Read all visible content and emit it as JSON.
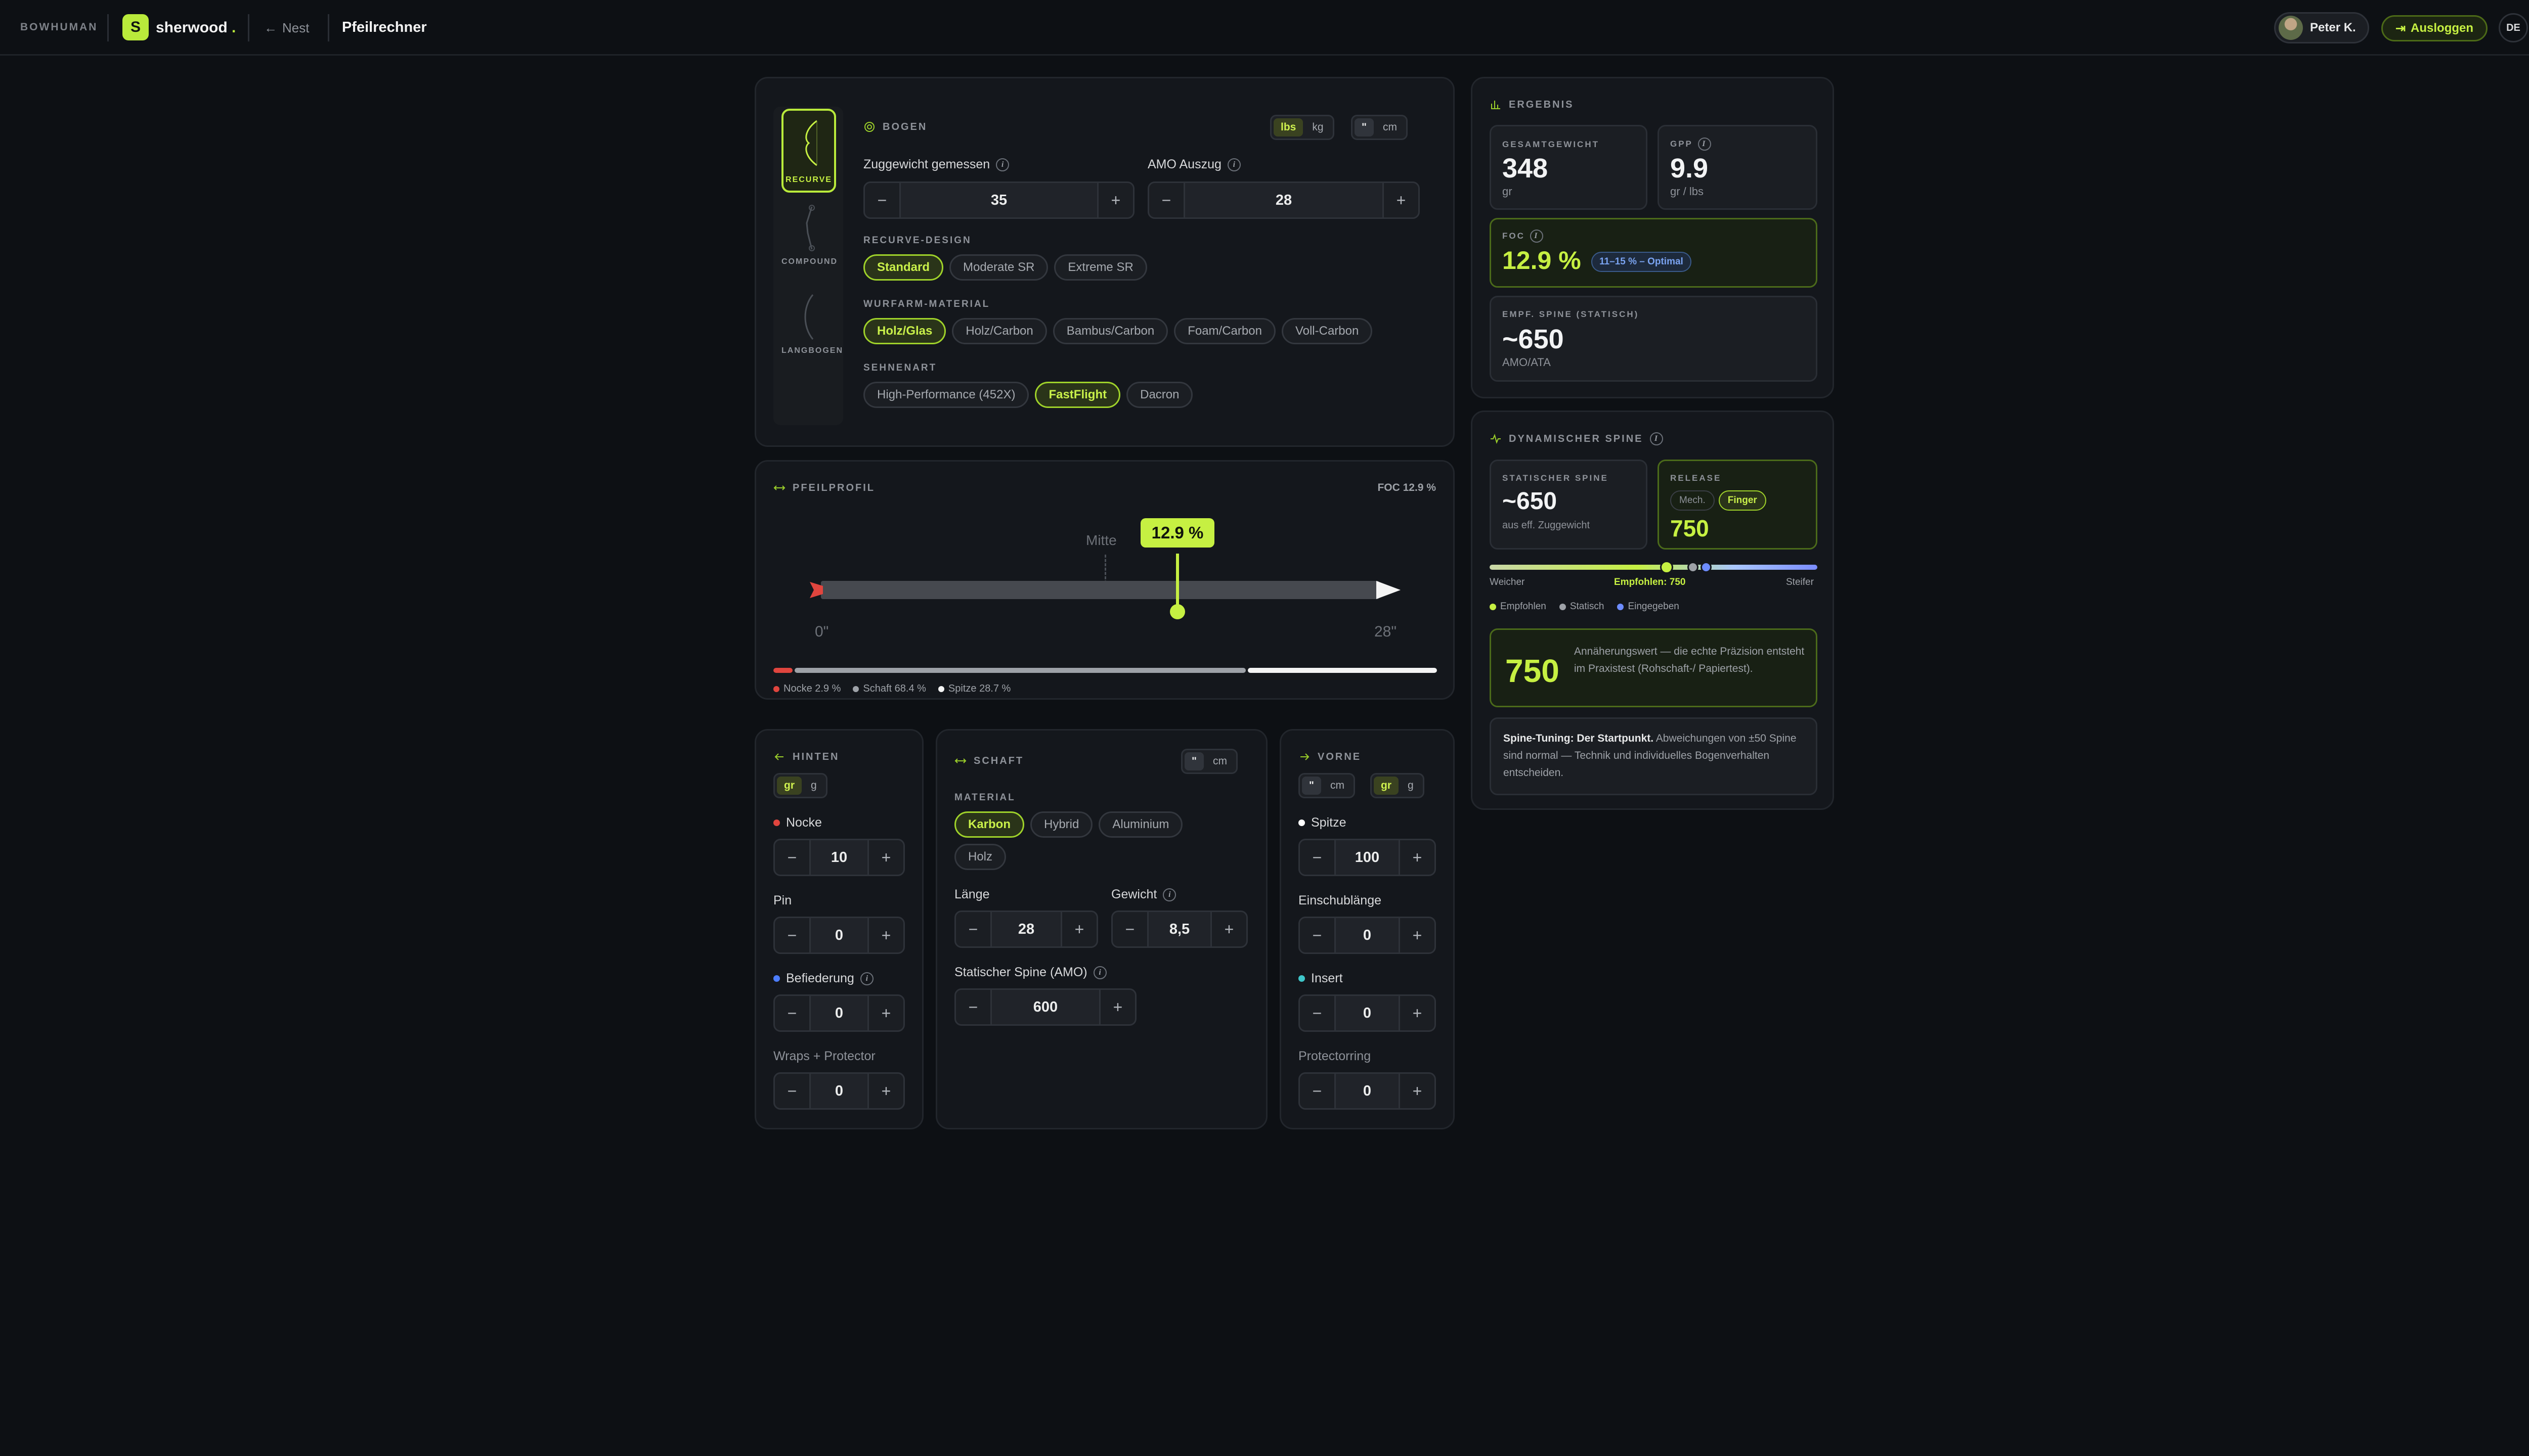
{
  "topbar": {
    "brand": "BOWHUMAN",
    "logo_letter": "S",
    "app_name": "sherwood",
    "app_dot": ".",
    "back_label": "Nest",
    "page_title": "Pfeilrechner",
    "user_name": "Peter K.",
    "logout_label": "Ausloggen",
    "lang": "DE"
  },
  "bow_types": [
    {
      "label": "RECURVE",
      "active": true
    },
    {
      "label": "COMPOUND",
      "active": false
    },
    {
      "label": "LANGBOGEN",
      "active": false
    }
  ],
  "bow": {
    "title": "BOGEN",
    "weight_units": [
      "lbs",
      "kg"
    ],
    "length_units": [
      "\"",
      "cm"
    ],
    "draw_weight_label": "Zuggewicht gemessen",
    "draw_weight": "35",
    "amo_label": "AMO Auszug",
    "amo": "28",
    "design_label": "RECURVE-DESIGN",
    "designs": [
      "Standard",
      "Moderate SR",
      "Extreme SR"
    ],
    "limb_label": "WURFARM-MATERIAL",
    "limbs": [
      "Holz/Glas",
      "Holz/Carbon",
      "Bambus/Carbon",
      "Foam/Carbon",
      "Voll-Carbon"
    ],
    "string_label": "SEHNENART",
    "strings": [
      "High-Performance (452X)",
      "FastFlight",
      "Dacron"
    ]
  },
  "profile": {
    "title": "PFEILPROFIL",
    "foc_label": "FOC 12.9 %",
    "mid_label": "Mitte",
    "foc_badge": "12.9 %",
    "start": "0\"",
    "end": "28\"",
    "foc_fraction": 0.129,
    "segments": [
      {
        "name": "Nocke 2.9 %",
        "pct": 2.9,
        "color": "#e0453e"
      },
      {
        "name": "Schaft 68.4 %",
        "pct": 68.4,
        "color": "#9ea2a8"
      },
      {
        "name": "Spitze 28.7 %",
        "pct": 28.7,
        "color": "#f4f4f4"
      }
    ]
  },
  "hinten": {
    "title": "HINTEN",
    "units": [
      "gr",
      "g"
    ],
    "fields": [
      {
        "label": "Nocke",
        "value": "10",
        "dot": "#e0453e"
      },
      {
        "label": "Pin",
        "value": "0"
      },
      {
        "label": "Befiederung",
        "value": "0",
        "dot": "#4c7dff",
        "info": true
      },
      {
        "label": "Wraps + Protector",
        "value": "0"
      }
    ]
  },
  "schaft": {
    "title": "SCHAFT",
    "units": [
      "\"",
      "cm"
    ],
    "material_label": "MATERIAL",
    "materials": [
      "Karbon",
      "Hybrid",
      "Aluminium",
      "Holz"
    ],
    "length_label": "Länge",
    "length": "28",
    "weight_label": "Gewicht",
    "weight": "8,5",
    "spine_label": "Statischer Spine (AMO)",
    "spine": "600"
  },
  "vorne": {
    "title": "VORNE",
    "units_len": [
      "\"",
      "cm"
    ],
    "units_w": [
      "gr",
      "g"
    ],
    "fields": [
      {
        "label": "Spitze",
        "value": "100",
        "dot": "#ffffff"
      },
      {
        "label": "Einschublänge",
        "value": "0"
      },
      {
        "label": "Insert",
        "value": "0",
        "dot": "#3ec6c9"
      },
      {
        "label": "Protectorring",
        "value": "0"
      }
    ]
  },
  "result": {
    "title": "ERGEBNIS",
    "total_label": "GESAMTGEWICHT",
    "total": "348",
    "total_unit": "gr",
    "gpp_label": "GPP",
    "gpp": "9.9",
    "gpp_unit": "gr / lbs",
    "foc_label": "FOC",
    "foc": "12.9 %",
    "foc_badge": "11–15 % – Optimal",
    "spine_label": "EMPF. SPINE (STATISCH)",
    "spine": "~650",
    "spine_unit": "AMO/ATA"
  },
  "dynamic": {
    "title": "DYNAMISCHER SPINE",
    "static_label": "STATISCHER SPINE",
    "static": "~650",
    "static_sub": "aus eff. Zuggewicht",
    "release_label": "RELEASE",
    "release_opts": [
      "Mech.",
      "Finger"
    ],
    "release_value": "750",
    "softer": "Weicher",
    "recommended": "Empfohlen: 750",
    "stiffer": "Steifer",
    "legend": [
      {
        "label": "Empfohlen",
        "color": "#c6f042"
      },
      {
        "label": "Statisch",
        "color": "#9ea2a8"
      },
      {
        "label": "Eingegeben",
        "color": "#6d8cff"
      }
    ],
    "marker_recommended": 0.54,
    "marker_static": 0.62,
    "marker_entered": 0.66,
    "big": "750",
    "note": "Annäherungswert — die echte Präzision entsteht im Praxistest (Rohschaft-/ Papiertest).",
    "tip_bold": "Spine-Tuning: Der Startpunkt.",
    "tip": " Abweichungen von ±50 Spine sind normal — Technik und individuelles Bogenverhalten entscheiden."
  }
}
